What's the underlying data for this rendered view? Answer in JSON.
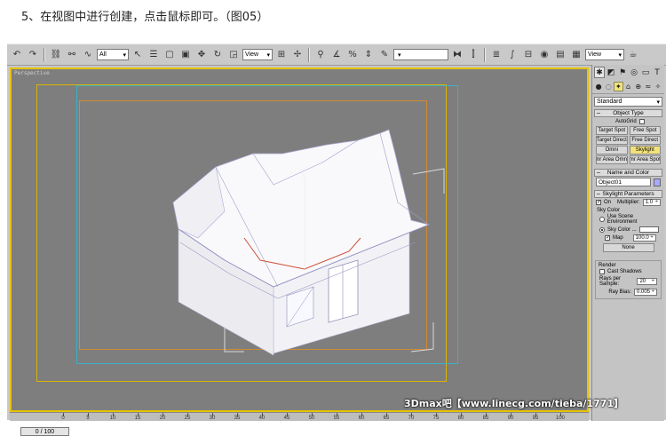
{
  "caption": "5、在视图中进行创建，点击鼠标即可。（图05）",
  "toolbar": {
    "selection_filter": "All",
    "reference_coord": "View",
    "named_selection": "",
    "render_view": "View"
  },
  "viewport": {
    "label": "Perspective"
  },
  "timeslider": {
    "label": "0 / 100"
  },
  "ruler": {
    "ticks": [
      "0",
      "5",
      "10",
      "15",
      "20",
      "25",
      "30",
      "35",
      "40",
      "45",
      "50",
      "55",
      "60",
      "65",
      "70",
      "75",
      "80",
      "85",
      "90",
      "95",
      "100"
    ]
  },
  "watermark": "3Dmax吧【www.linecg.com/tieba/1771】",
  "command_panel": {
    "category_dropdown": "Standard",
    "object_type": {
      "title": "Object Type",
      "autogrid_label": "AutoGrid",
      "buttons": [
        "Target Spot",
        "Free Spot",
        "Target Direct",
        "Free Direct",
        "Omni",
        "Skylight",
        "mr Area Omni",
        "mr Area Spot"
      ],
      "active_button": "Skylight"
    },
    "name_and_color": {
      "title": "Name and Color",
      "name_value": "Object01",
      "swatch_color": "#a9a9ff"
    },
    "skylight_parameters": {
      "title": "Skylight Parameters",
      "on_label": "On",
      "multiplier_label": "Multiplier:",
      "multiplier_value": "1.0",
      "sky_color_title": "Sky Color",
      "use_scene_env_label": "Use Scene Environment",
      "sky_color_label": "Sky Color ...",
      "map_label": "Map",
      "map_value": "100.0",
      "none_button": "None"
    },
    "render": {
      "title": "Render",
      "cast_shadows_label": "Cast Shadows",
      "rays_label": "Rays per Sample:",
      "rays_value": "20",
      "bias_label": "Ray Bias:",
      "bias_value": "0.005"
    }
  }
}
